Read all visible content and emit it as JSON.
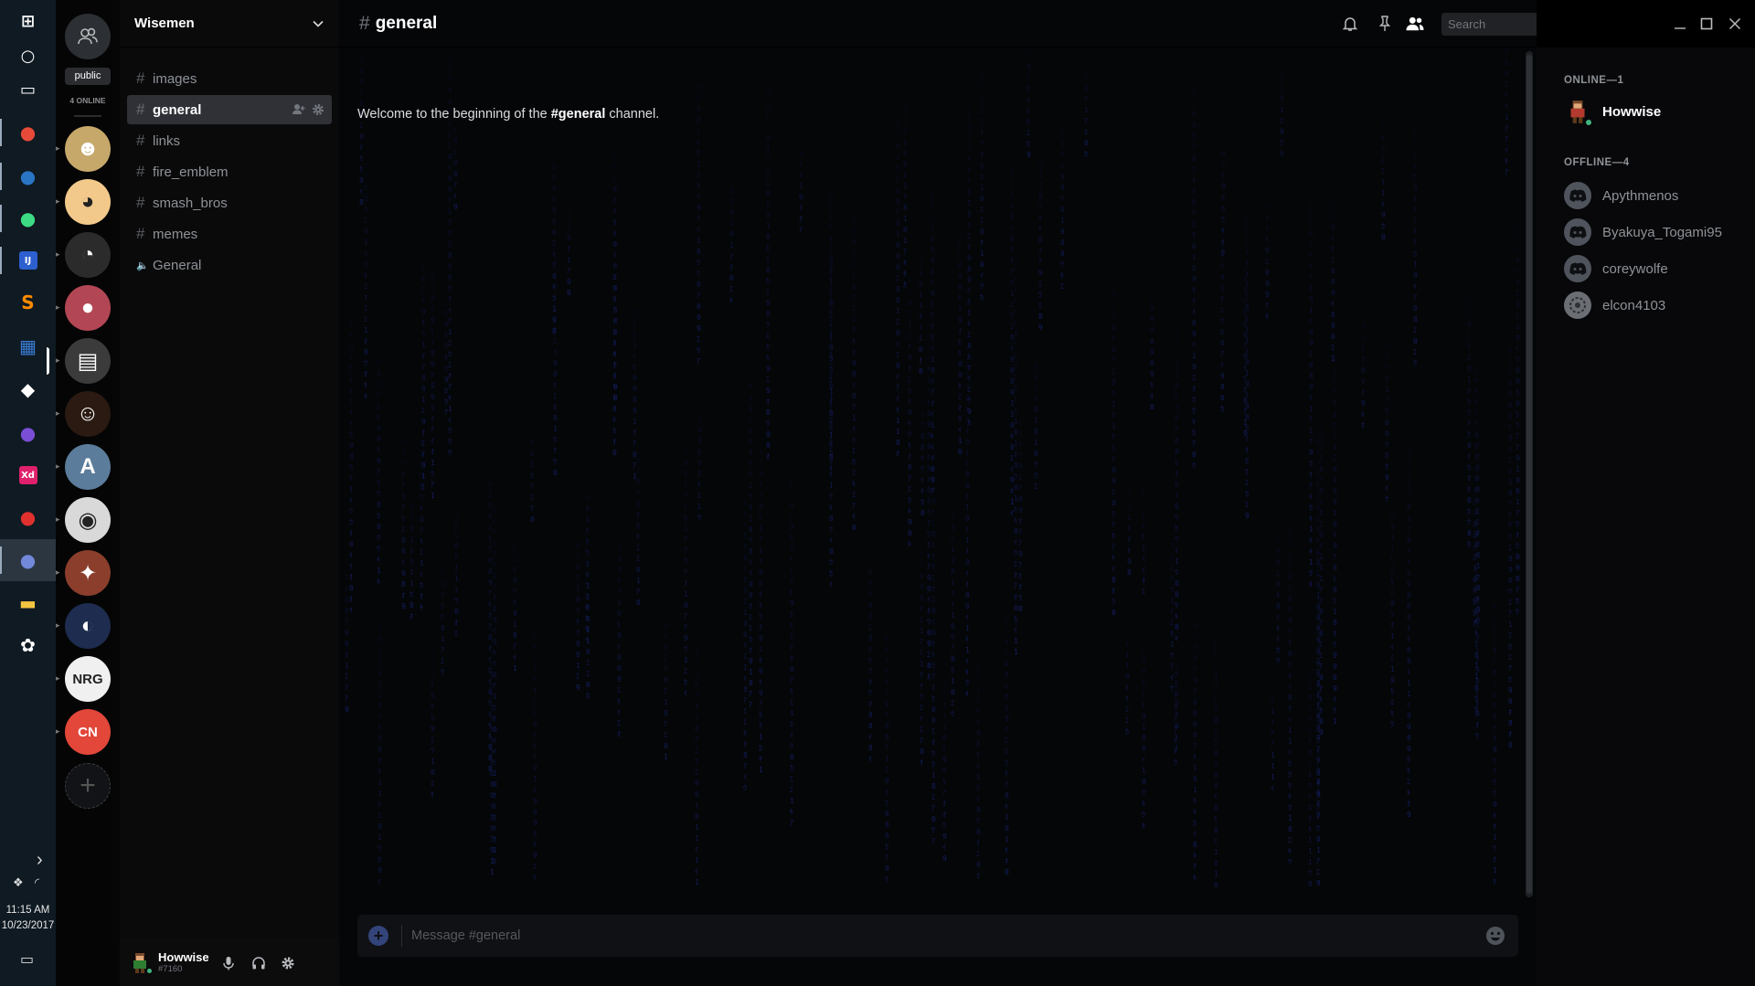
{
  "taskbar": {
    "time": "11:15 AM",
    "date": "10/23/2017",
    "icons": [
      {
        "name": "windows-start",
        "glyph": "⊞",
        "color": "#ffffff"
      },
      {
        "name": "cortana",
        "glyph": "○",
        "color": "#ffffff"
      },
      {
        "name": "task-view",
        "glyph": "▭",
        "color": "#ffffff"
      },
      {
        "name": "chrome",
        "glyph": "●",
        "color": "#e84a3a"
      },
      {
        "name": "steam",
        "glyph": "●",
        "color": "#2a75c4"
      },
      {
        "name": "android-studio",
        "glyph": "●",
        "color": "#3ddc84"
      },
      {
        "name": "intellij",
        "glyph": "IJ",
        "color": "#2d5fcf"
      },
      {
        "name": "sublime-text",
        "glyph": "S",
        "color": "#ff8a00"
      },
      {
        "name": "trello",
        "glyph": "▦",
        "color": "#3a7cd6"
      },
      {
        "name": "unity",
        "glyph": "◆",
        "color": "#ffffff"
      },
      {
        "name": "gitkraken",
        "glyph": "●",
        "color": "#7a4fd6"
      },
      {
        "name": "adobe-xd",
        "glyph": "Xd",
        "color": "#e0206b"
      },
      {
        "name": "creative-cloud",
        "glyph": "●",
        "color": "#e0312e"
      },
      {
        "name": "discord",
        "glyph": "●",
        "color": "#7289da"
      },
      {
        "name": "file-explorer",
        "glyph": "▬",
        "color": "#f4c542"
      },
      {
        "name": "app-launcher",
        "glyph": "✿",
        "color": "#ffffff"
      }
    ]
  },
  "guilds": {
    "public_label": "public",
    "online_label": "4 ONLINE",
    "servers": [
      {
        "name": "server-1",
        "bg": "#c6a86a",
        "glyph": "☻"
      },
      {
        "name": "server-2",
        "bg": "#f2c98b",
        "glyph": "◕"
      },
      {
        "name": "server-3",
        "bg": "#2b2b2b",
        "glyph": "◔"
      },
      {
        "name": "server-4",
        "bg": "#b34654",
        "glyph": "●"
      },
      {
        "name": "server-5",
        "bg": "#3b3b3b",
        "glyph": "▤"
      },
      {
        "name": "server-6",
        "bg": "#2a1a12",
        "glyph": "☺"
      },
      {
        "name": "server-7",
        "bg": "#5b7c9a",
        "glyph": "A"
      },
      {
        "name": "server-8",
        "bg": "#d9d9d9",
        "glyph": "◉"
      },
      {
        "name": "server-9",
        "bg": "#8a3e2b",
        "glyph": "✦"
      },
      {
        "name": "server-10",
        "bg": "#1d2c4f",
        "glyph": "◐"
      },
      {
        "name": "server-11",
        "bg": "#f0f0f0",
        "glyph": "NRG"
      },
      {
        "name": "server-12",
        "bg": "#e2473a",
        "glyph": "CN"
      }
    ]
  },
  "server": {
    "name": "Wisemen"
  },
  "channels": [
    {
      "name": "images",
      "type": "text",
      "selected": false
    },
    {
      "name": "general",
      "type": "text",
      "selected": true
    },
    {
      "name": "links",
      "type": "text",
      "selected": false
    },
    {
      "name": "fire_emblem",
      "type": "text",
      "selected": false
    },
    {
      "name": "smash_bros",
      "type": "text",
      "selected": false
    },
    {
      "name": "memes",
      "type": "text",
      "selected": false
    },
    {
      "name": "General",
      "type": "voice",
      "selected": false
    }
  ],
  "user": {
    "name": "Howwise",
    "tag": "#7160"
  },
  "chat": {
    "channel": "general",
    "search_placeholder": "Search",
    "welcome_prefix": "Welcome to the beginning of the ",
    "welcome_channel": "#general",
    "welcome_suffix": " channel.",
    "message_placeholder": "Message #general"
  },
  "members": {
    "online_header": "ONLINE—1",
    "offline_header": "OFFLINE—4",
    "online": [
      {
        "name": "Howwise"
      }
    ],
    "offline": [
      {
        "name": "Apythmenos"
      },
      {
        "name": "Byakuya_Togami95"
      },
      {
        "name": "coreywolfe"
      },
      {
        "name": "elcon4103"
      }
    ]
  },
  "colors": {
    "accent": "#7289da",
    "online": "#43b581",
    "matrix": "#1a2b8a"
  }
}
